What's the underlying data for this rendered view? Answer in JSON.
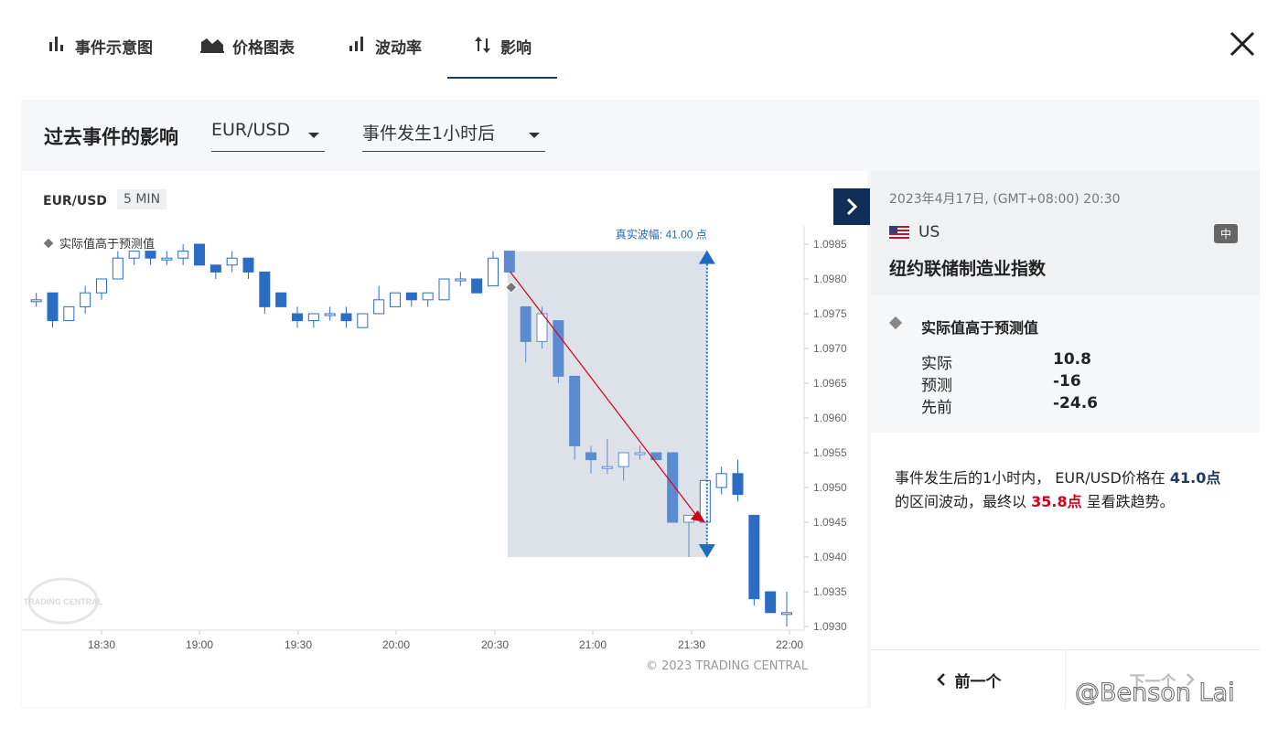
{
  "tabs": [
    {
      "label": "事件示意图",
      "icon": "bar-chart-icon"
    },
    {
      "label": "价格图表",
      "icon": "area-chart-icon"
    },
    {
      "label": "波动率",
      "icon": "volatility-icon"
    },
    {
      "label": "影响",
      "icon": "up-down-arrows-icon"
    }
  ],
  "panel": {
    "title": "过去事件的影响",
    "pair_select": "EUR/USD",
    "time_select": "事件发生1小时后"
  },
  "chart": {
    "pair": "EUR/USD",
    "timeframe": "5 MIN",
    "legend": "实际值高于预测值",
    "range_label": "真实波幅: 41.00 点",
    "copyright": "© 2023 TRADING CENTRAL",
    "logo_text": "TRADING CENTRAL"
  },
  "chart_data": {
    "type": "candlestick",
    "title": "",
    "x_ticks": [
      "18:30",
      "19:00",
      "19:30",
      "20:00",
      "20:30",
      "21:00",
      "21:30",
      "22:00"
    ],
    "y_ticks": [
      "1.0985",
      "1.0980",
      "1.0975",
      "1.0970",
      "1.0965",
      "1.0960",
      "1.0955",
      "1.0950",
      "1.0945",
      "1.0940",
      "1.0935",
      "1.0930"
    ],
    "ylim": [
      1.0929,
      1.0987
    ],
    "event_time": "20:30",
    "highlight_range": [
      1.094,
      1.0984
    ],
    "trend_start": 1.0981,
    "trend_end": 1.0945,
    "candles": [
      [
        1.0977,
        1.0978,
        1.0976,
        1.0977
      ],
      [
        1.0978,
        1.0977,
        1.0973,
        1.0974
      ],
      [
        1.0974,
        1.0975,
        1.0974,
        1.0976
      ],
      [
        1.0976,
        1.0979,
        1.0975,
        1.0978
      ],
      [
        1.0978,
        1.098,
        1.0977,
        1.098
      ],
      [
        1.098,
        1.0984,
        1.098,
        1.0983
      ],
      [
        1.0983,
        1.0984,
        1.0982,
        1.0984
      ],
      [
        1.0984,
        1.0983,
        1.0982,
        1.0983
      ],
      [
        1.0983,
        1.0984,
        1.0982,
        1.0983
      ],
      [
        1.0983,
        1.0985,
        1.0982,
        1.0984
      ],
      [
        1.0985,
        1.0985,
        1.0982,
        1.0982
      ],
      [
        1.0982,
        1.0982,
        1.098,
        1.0981
      ],
      [
        1.0982,
        1.0984,
        1.0981,
        1.0983
      ],
      [
        1.0983,
        1.0983,
        1.098,
        1.0981
      ],
      [
        1.0981,
        1.0981,
        1.0975,
        1.0976
      ],
      [
        1.0978,
        1.0978,
        1.0976,
        1.0976
      ],
      [
        1.0975,
        1.0976,
        1.0973,
        1.0974
      ],
      [
        1.0974,
        1.0975,
        1.0973,
        1.0975
      ],
      [
        1.0975,
        1.0976,
        1.0974,
        1.0975
      ],
      [
        1.0975,
        1.0976,
        1.0973,
        1.0974
      ],
      [
        1.0973,
        1.0975,
        1.0973,
        1.0975
      ],
      [
        1.0975,
        1.0979,
        1.0975,
        1.0977
      ],
      [
        1.0976,
        1.0978,
        1.0976,
        1.0978
      ],
      [
        1.0978,
        1.0978,
        1.0976,
        1.0977
      ],
      [
        1.0977,
        1.0978,
        1.0976,
        1.0978
      ],
      [
        1.0977,
        1.098,
        1.0977,
        1.098
      ],
      [
        1.098,
        1.0981,
        1.0979,
        1.098
      ],
      [
        1.098,
        1.098,
        1.0978,
        1.0978
      ],
      [
        1.0979,
        1.0984,
        1.0979,
        1.0983
      ],
      [
        1.0984,
        1.0984,
        1.0981,
        1.0981
      ],
      [
        1.0976,
        1.0976,
        1.0968,
        1.0971
      ],
      [
        1.0971,
        1.0976,
        1.097,
        1.0975
      ],
      [
        1.0974,
        1.0974,
        1.0965,
        1.0966
      ],
      [
        1.0966,
        1.0966,
        1.0954,
        1.0956
      ],
      [
        1.0955,
        1.0956,
        1.0952,
        1.0954
      ],
      [
        1.0953,
        1.0957,
        1.0952,
        1.0953
      ],
      [
        1.0953,
        1.0955,
        1.0951,
        1.0955
      ],
      [
        1.0955,
        1.0956,
        1.0954,
        1.0955
      ],
      [
        1.0955,
        1.0955,
        1.0954,
        1.0954
      ],
      [
        1.0955,
        1.0955,
        1.0945,
        1.0945
      ],
      [
        1.0945,
        1.0946,
        1.094,
        1.0946
      ],
      [
        1.0945,
        1.0951,
        1.0945,
        1.0951
      ],
      [
        1.095,
        1.0953,
        1.0949,
        1.0952
      ],
      [
        1.0952,
        1.0954,
        1.0948,
        1.0949
      ],
      [
        1.0946,
        1.0946,
        1.0933,
        1.0934
      ],
      [
        1.0935,
        1.0935,
        1.0933,
        1.0932
      ],
      [
        1.0932,
        1.0935,
        1.093,
        1.0932
      ]
    ]
  },
  "event": {
    "datetime": "2023年4月17日, (GMT+08:00) 20:30",
    "country": "US",
    "importance": "中",
    "name": "纽约联储制造业指数",
    "result": "实际值高于预测值",
    "rows": [
      {
        "label": "实际",
        "value": "10.8"
      },
      {
        "label": "预测",
        "value": "-16"
      },
      {
        "label": "先前",
        "value": "-24.6"
      }
    ],
    "desc_1": "事件发生后的1小时内， EUR/USD价格在 ",
    "desc_range": "41.0点",
    "desc_2": "的区间波动，最终以 ",
    "desc_move": "35.8点",
    "desc_3": " 呈看跌趋势。",
    "prev": "前一个",
    "next": "下一个"
  },
  "watermark": "@Benson Lai",
  "colors": {
    "bull": "#2b6cc4",
    "bear": "#2b6cc4",
    "highlight": "#dde1e8",
    "arrow": "#1f6bbf",
    "trend": "#d0021b",
    "navy": "#0f2f58"
  }
}
